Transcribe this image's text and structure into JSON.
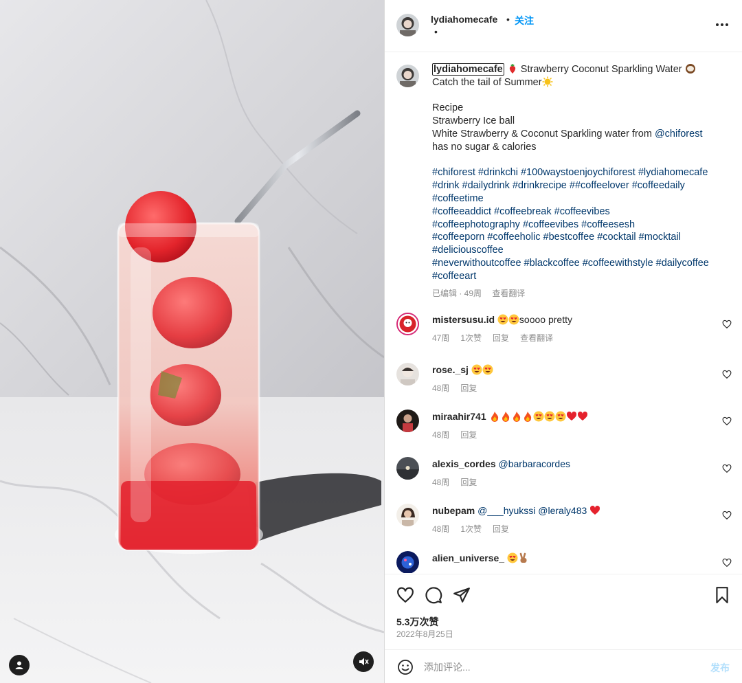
{
  "post": {
    "username": "lydiahomecafe",
    "follow_label": "关注",
    "separator": "•",
    "location_dot": "•"
  },
  "caption": {
    "username": "lydiahomecafe",
    "line1_text": " Strawberry Coconut Sparkling Water ",
    "line1_tail": " Catch the tail of Summer",
    "recipe_title": "Recipe",
    "recipe_item1": "Strawberry Ice ball",
    "recipe_item2_prefix": "White Strawberry & Coconut Sparkling water from ",
    "recipe_item2_mention": "@chiforest",
    "recipe_item3": "has no sugar & calories",
    "hashtags_block1": "#chiforest #drinkchi #100waystoenjoychiforest #lydiahomecafe #drink #dailydrink #drinkrecipe ##coffeelover #coffeedaily #coffeetime",
    "hashtags_lines": [
      "#coffeeaddict #coffeebreak #coffeevibes",
      "#coffeephotography #coffeevibes #coffeesesh",
      "#coffeeporn #coffeeholic #bestcoffee #cocktail #mocktail",
      "#deliciouscoffee",
      "#neverwithoutcoffee #blackcoffee #coffeewithstyle #dailycoffee",
      "#coffeeart"
    ],
    "edited": "已编辑 · 49周",
    "translate": "查看翻译"
  },
  "comments": [
    {
      "user": "mistersusu.id",
      "text": "soooo pretty",
      "time": "47周",
      "likes": "1次赞",
      "reply": "回复",
      "translate": "查看翻译"
    },
    {
      "user": "rose._sj",
      "text": "",
      "time": "48周",
      "likes": "",
      "reply": "回复",
      "translate": ""
    },
    {
      "user": "miraahir741",
      "text": "",
      "time": "48周",
      "likes": "",
      "reply": "回复",
      "translate": ""
    },
    {
      "user": "alexis_cordes",
      "text": "@barbaracordes",
      "time": "48周",
      "likes": "",
      "reply": "回复",
      "translate": ""
    },
    {
      "user": "nubepam",
      "text": "@___hyukssi @leraly483",
      "time": "48周",
      "likes": "1次赞",
      "reply": "回复",
      "translate": ""
    },
    {
      "user": "alien_universe_",
      "text": "",
      "time": "",
      "likes": "",
      "reply": "",
      "translate": ""
    }
  ],
  "stats": {
    "likes": "5.3万次赞",
    "date": "2022年8月25日"
  },
  "add_comment": {
    "placeholder": "添加评论...",
    "post_label": "发布"
  },
  "icons": {
    "more": "more-options-icon",
    "like": "heart-icon",
    "comment": "comment-icon",
    "share": "paper-plane-icon",
    "save": "bookmark-icon",
    "emoji": "smiley-icon",
    "tag": "user-tag-icon",
    "mute": "speaker-muted-icon"
  },
  "colors": {
    "link": "#00376b",
    "accent": "#0095f6",
    "muted": "#8e8e8e"
  }
}
